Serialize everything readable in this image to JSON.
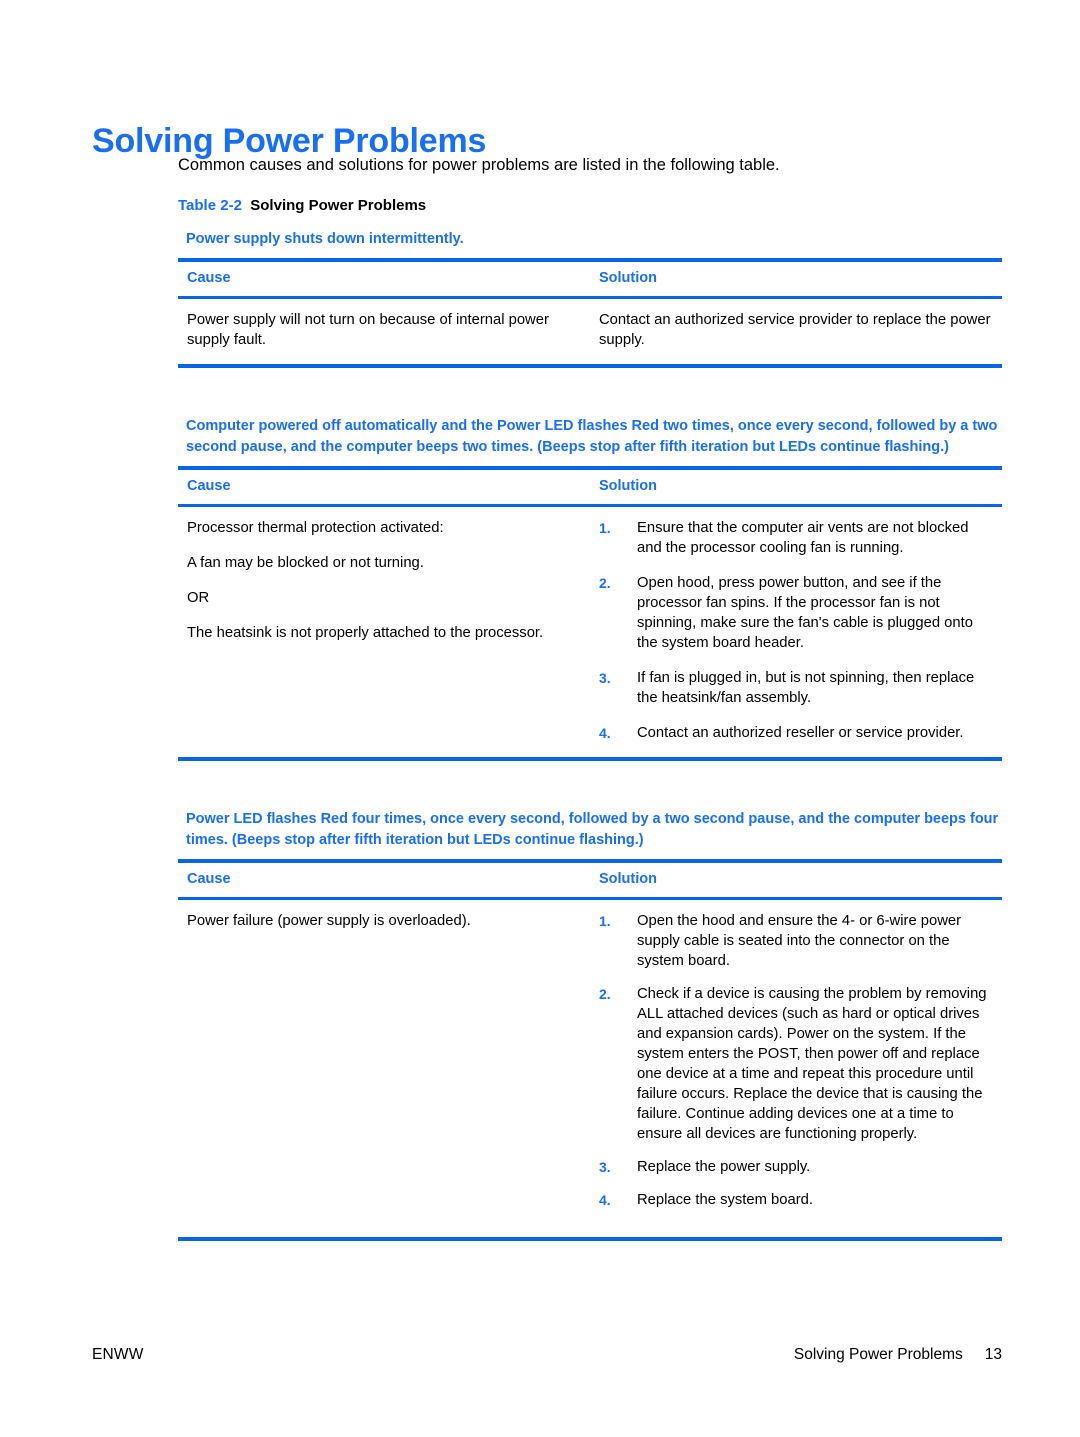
{
  "page": {
    "heading": "Solving Power Problems",
    "intro": "Common causes and solutions for power problems are listed in the following table.",
    "caption_label": "Table 2-2",
    "caption_title": "Solving Power Problems",
    "accent_color": "#1a6ff0",
    "rule_color": "#0a64e8"
  },
  "columns": {
    "cause": "Cause",
    "solution": "Solution"
  },
  "tables": [
    {
      "title": "Power supply shuts down intermittently.",
      "cause": [
        "Power supply will not turn on because of internal power supply fault."
      ],
      "solution_paragraphs": [
        "Contact an authorized service provider to replace the power supply."
      ],
      "solution_steps": []
    },
    {
      "title": "Computer powered off automatically and the Power LED flashes Red two times, once every second, followed by a two second pause, and the computer beeps two times. (Beeps stop after fifth iteration but LEDs continue flashing.)",
      "cause": [
        "Processor thermal protection activated:",
        "A fan may be blocked or not turning.",
        "OR",
        "The heatsink is not properly attached to the processor."
      ],
      "solution_paragraphs": [],
      "solution_steps": [
        {
          "num": "1.",
          "text": "Ensure that the computer air vents are not blocked and the processor cooling fan is running."
        },
        {
          "num": "2.",
          "text": "Open hood, press power button, and see if the processor fan spins. If the processor fan is not spinning, make sure the fan's cable is plugged onto the system board header."
        },
        {
          "num": "3.",
          "text": "If fan is plugged in, but is not spinning, then replace the heatsink/fan assembly."
        },
        {
          "num": "4.",
          "text": "Contact an authorized reseller or service provider."
        }
      ]
    },
    {
      "title": "Power LED flashes Red four times, once every second, followed by a two second pause, and the computer beeps four times. (Beeps stop after fifth iteration but LEDs continue flashing.)",
      "cause": [
        "Power failure (power supply is overloaded)."
      ],
      "solution_paragraphs": [],
      "solution_steps": [
        {
          "num": "1.",
          "text": "Open the hood and ensure the 4- or 6-wire power supply cable is seated into the connector on the system board."
        },
        {
          "num": "2.",
          "text": "Check if a device is causing the problem by removing ALL attached devices (such as hard or optical drives and expansion cards). Power on the system. If the system enters the POST, then power off and replace one device at a time and repeat this procedure until failure occurs. Replace the device that is causing the failure. Continue adding devices one at a time to ensure all devices are functioning properly."
        },
        {
          "num": "3.",
          "text": "Replace the power supply."
        },
        {
          "num": "4.",
          "text": "Replace the system board."
        }
      ]
    }
  ],
  "footer": {
    "left": "ENWW",
    "section": "Solving Power Problems",
    "page_number": "13"
  }
}
